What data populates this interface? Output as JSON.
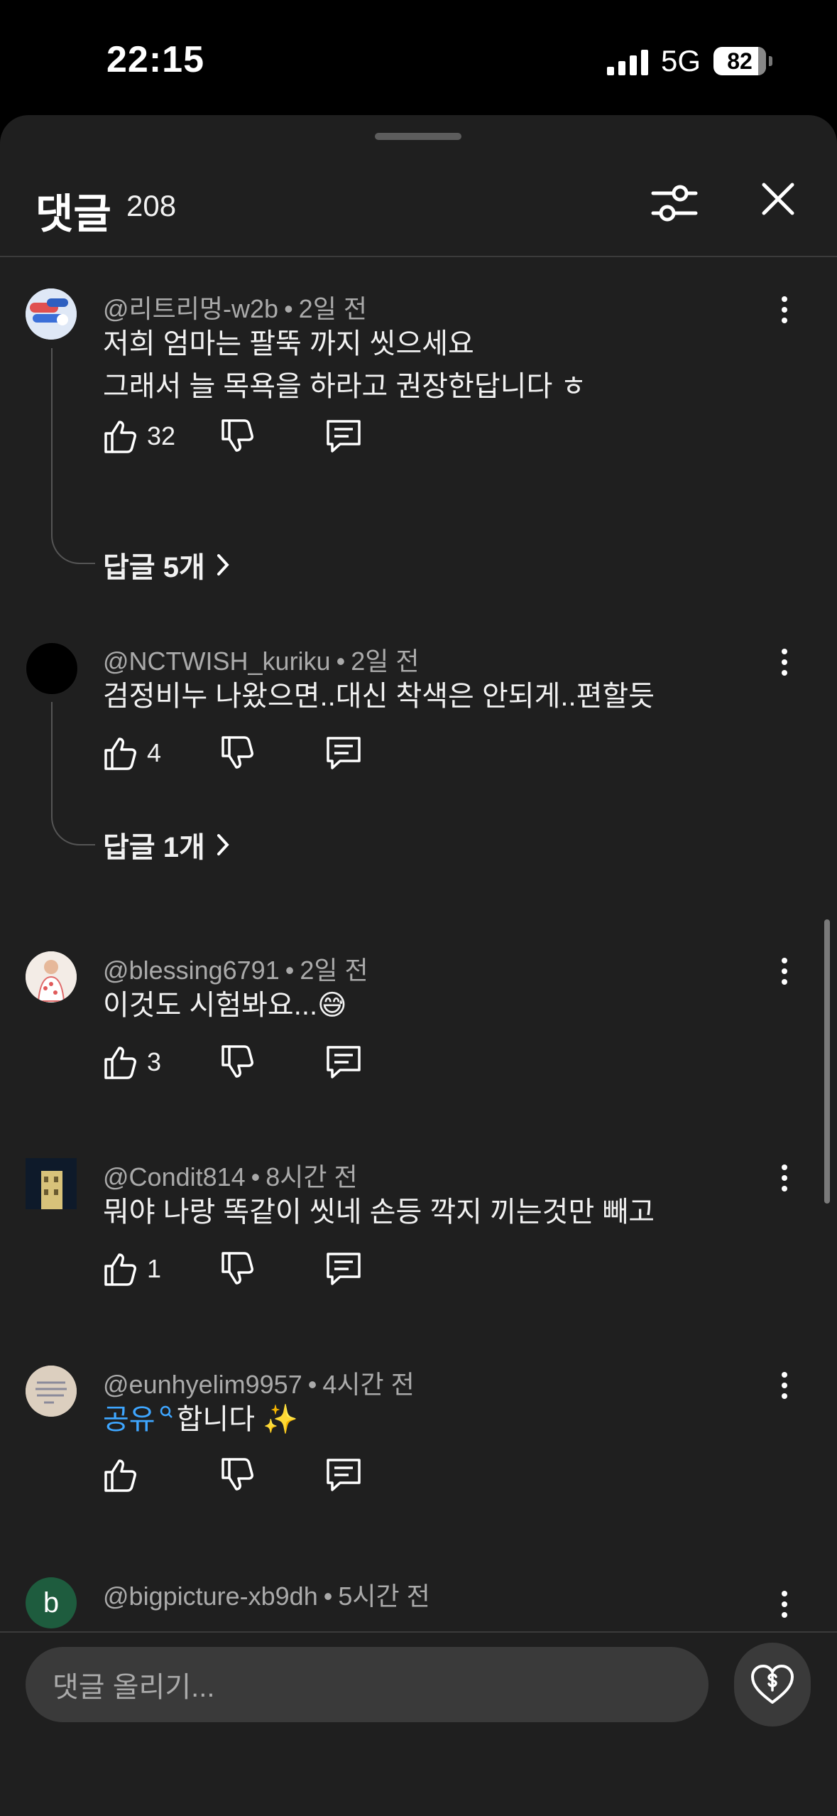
{
  "status": {
    "time": "22:15",
    "network": "5G",
    "battery": "82"
  },
  "header": {
    "title": "댓글",
    "count": "208"
  },
  "comments": [
    {
      "author": "@리트리멍-w2b",
      "time": "2일 전",
      "lines": [
        "저희 엄마는 팔뚝 까지 씻으세요",
        "그래서 늘 목욕을 하라고 권장한답니다 ㅎ"
      ],
      "likes": "32",
      "replies": "답글 5개"
    },
    {
      "author": "@NCTWISH_kuriku",
      "time": "2일 전",
      "lines": [
        "검정비누 나왔으면..대신 착색은 안되게..편할듯"
      ],
      "likes": "4",
      "replies": "답글 1개"
    },
    {
      "author": "@blessing6791",
      "time": "2일 전",
      "lines": [
        "이것도 시험봐요...😅"
      ],
      "likes": "3"
    },
    {
      "author": "@Condit814",
      "time": "8시간 전",
      "lines": [
        "뭐야 나랑 똑같이 씻네 손등 깍지 끼는것만 빼고"
      ],
      "likes": "1"
    },
    {
      "author": "@eunhyelim9957",
      "time": "4시간 전",
      "link_text": "공유",
      "rest_text": "합니다 ✨",
      "likes": ""
    },
    {
      "author": "@bigpicture-xb9dh",
      "time": "5시간 전",
      "avatar_letter": "b"
    }
  ],
  "composer": {
    "placeholder": "댓글 올리기..."
  },
  "colors": {
    "background": "#1f1f1f",
    "link": "#3ea6ff",
    "meta": "#aaaaaa"
  }
}
